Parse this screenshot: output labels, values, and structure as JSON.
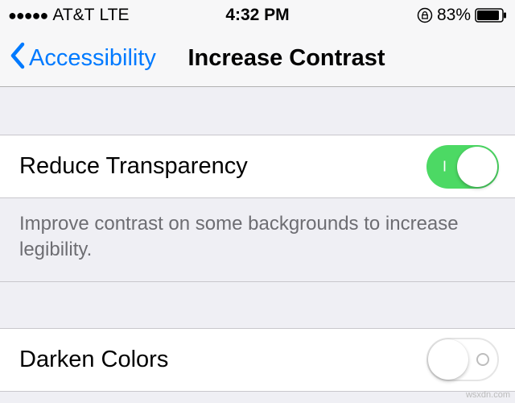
{
  "status_bar": {
    "signal": "●●●●●",
    "carrier": "AT&T",
    "network": "LTE",
    "time": "4:32 PM",
    "battery_percent": "83%"
  },
  "nav": {
    "back_label": "Accessibility",
    "title": "Increase Contrast"
  },
  "settings": {
    "reduce_transparency": {
      "label": "Reduce Transparency",
      "on": true,
      "footer": "Improve contrast on some backgrounds to increase legibility."
    },
    "darken_colors": {
      "label": "Darken Colors",
      "on": false
    }
  },
  "watermark": "wsxdn.com"
}
